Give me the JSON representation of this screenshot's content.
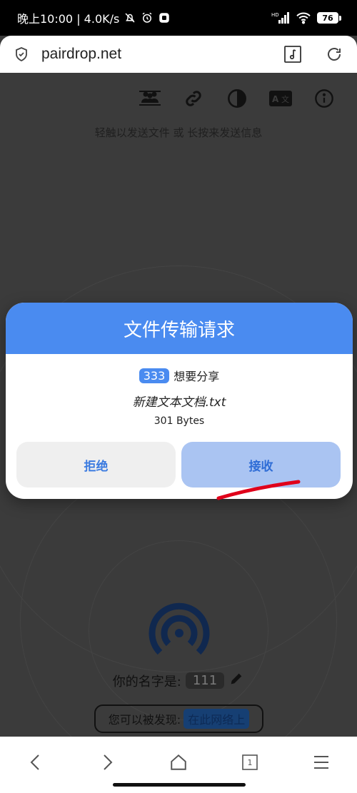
{
  "status_bar": {
    "left_text": "晚上10:00 | 4.0K/s",
    "battery": "76",
    "network_label": "HD"
  },
  "browser": {
    "url": "pairdrop.net"
  },
  "app": {
    "hint": "轻触以发送文件 或 长按来发送信息",
    "name_label": "你的名字是:",
    "name_value": "111",
    "discover_label": "您可以被发现:",
    "discover_value": "在此网络上"
  },
  "dialog": {
    "title": "文件传输请求",
    "sender": "333",
    "sender_suffix": "想要分享",
    "file_name": "新建文本文档.txt",
    "file_size": "301 Bytes",
    "reject_label": "拒绝",
    "accept_label": "接收"
  },
  "colors": {
    "accent": "#4a8bf0",
    "accept_bg": "#aac4f2",
    "annotation": "#e0001a"
  },
  "icons": {
    "toolbar": [
      "paired-devices-icon",
      "pair-link-icon",
      "theme-contrast-icon",
      "language-icon",
      "info-icon"
    ],
    "nav": [
      "back-icon",
      "forward-icon",
      "home-icon",
      "tabs-icon",
      "menu-icon"
    ]
  },
  "nav": {
    "tab_count": "1"
  }
}
